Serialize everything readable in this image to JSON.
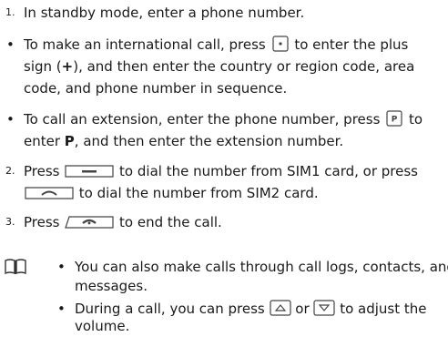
{
  "steps": [
    {
      "num": "1.",
      "text": "In standby mode, enter a phone number."
    },
    {
      "num": "2.",
      "line1_a": "Press",
      "line1_b": "to dial the number from SIM1 card, or press",
      "line2": "to dial the number from SIM2 card."
    },
    {
      "num": "3.",
      "text_a": "Press",
      "text_b": "to end the call."
    }
  ],
  "bullets": [
    {
      "line1_a": "To make an international call, press",
      "line1_b": "to enter the plus",
      "line2_a": "sign (",
      "line2_bold": "+",
      "line2_b": "), and then enter the country or region code, area",
      "line3": "code, and phone number in sequence."
    },
    {
      "line1_a": "To call an extension, enter the phone number, press",
      "line1_b": "to",
      "line2_a": "enter",
      "line2_bold": "P",
      "line2_b": ", and then enter the extension number."
    }
  ],
  "note": {
    "icon": "book-icon",
    "items": [
      {
        "line1": "You can also make calls through call logs, contacts, and",
        "line2": "messages."
      },
      {
        "line1_a": "During a call, you can press",
        "line1_or": "or",
        "line1_b": "to adjust the",
        "line2": "volume."
      }
    ]
  },
  "keys": {
    "plus_key": "P",
    "ext_key": "P",
    "bullet_symbol": "•"
  },
  "colors": {
    "text": "#1a1a1a",
    "key_outline": "#444444",
    "key_fill": "#ffffff"
  }
}
